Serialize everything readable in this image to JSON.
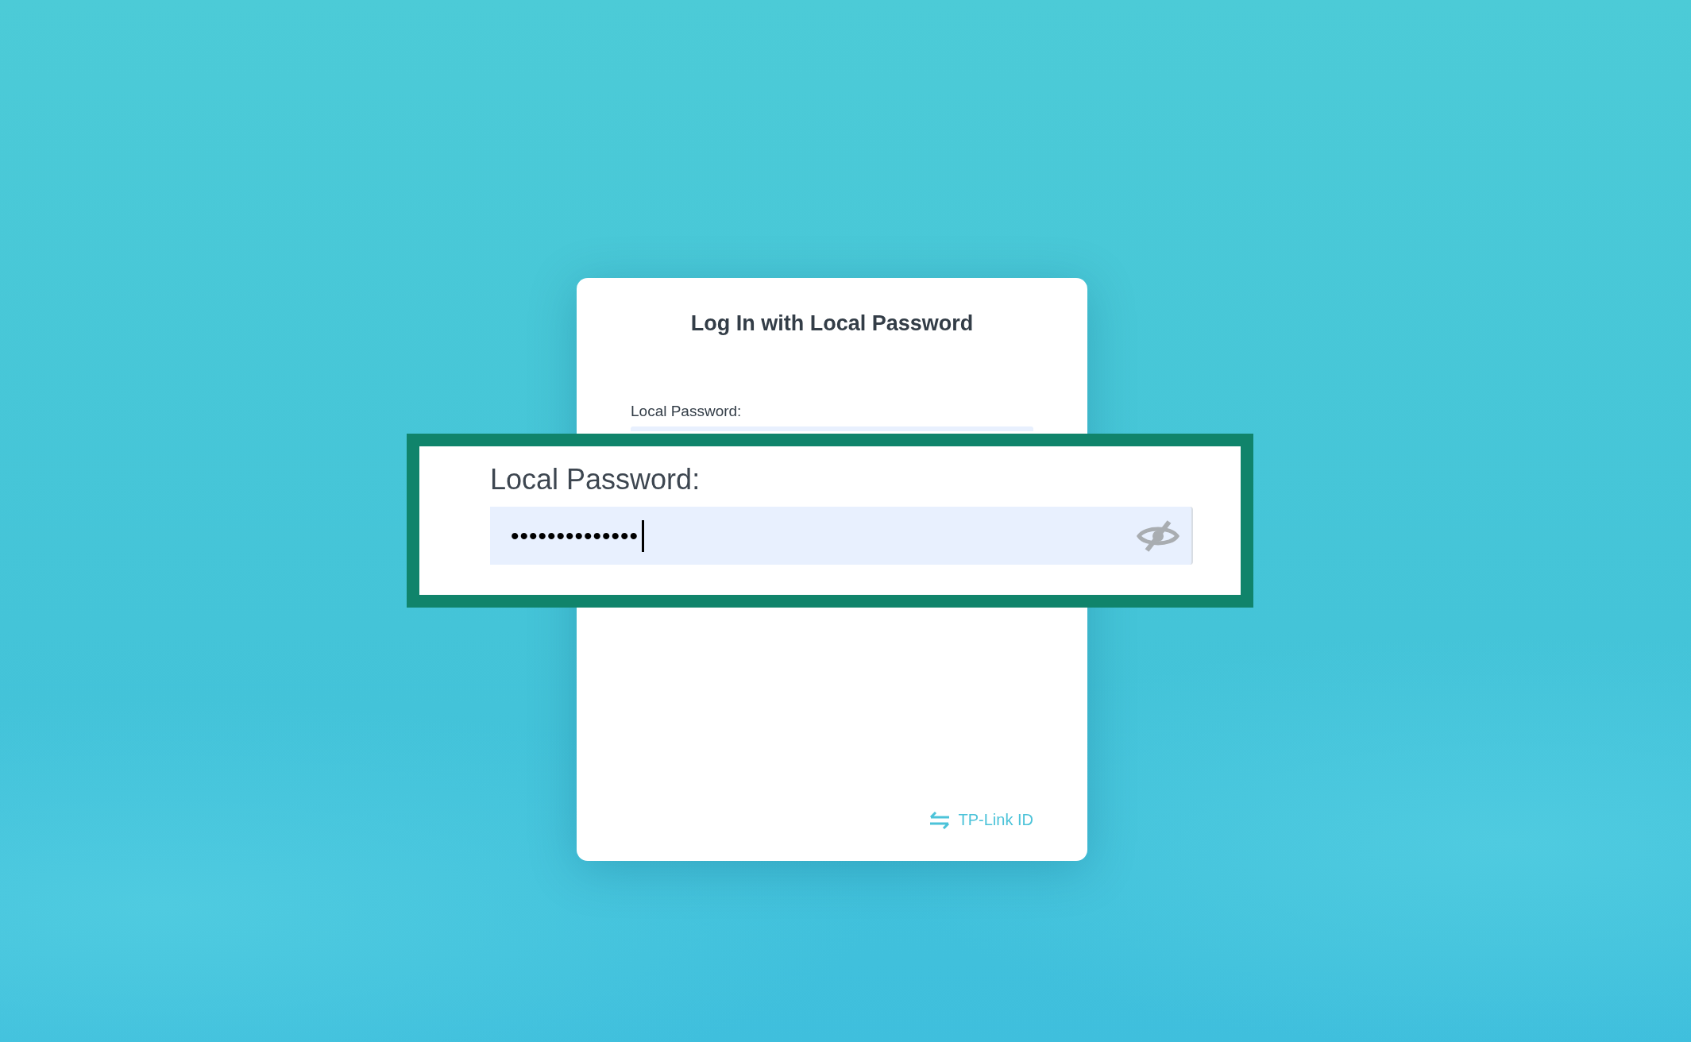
{
  "card": {
    "title": "Log In with Local Password",
    "password_label": "Local Password:",
    "link": "TP-Link ID"
  },
  "zoom_callout": {
    "label": "Local Password:",
    "password_field": {
      "value": "••••••••••••••",
      "focused": true,
      "show_password": false
    }
  }
}
